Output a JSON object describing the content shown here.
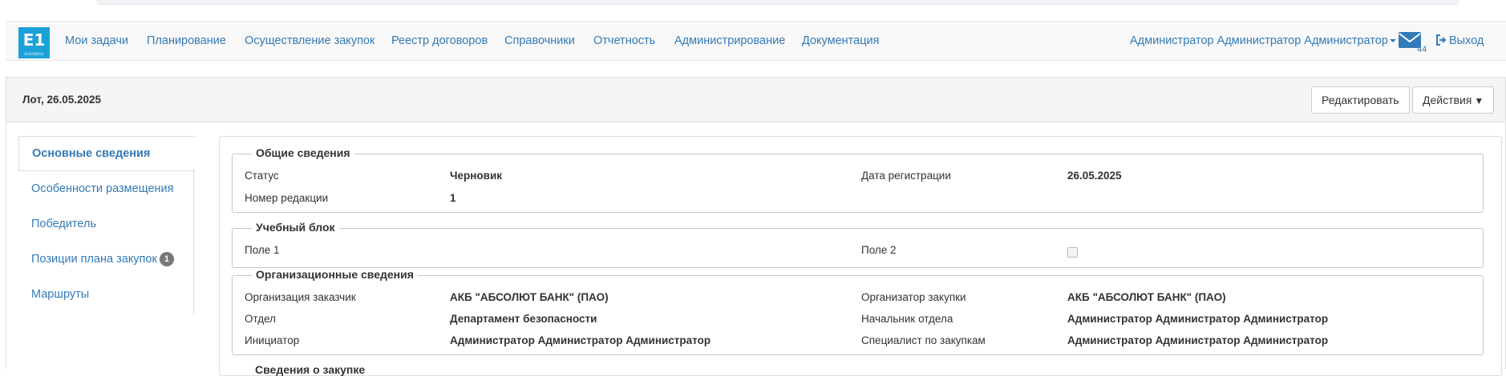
{
  "app": {
    "logo_text": "E1",
    "logo_subtext": "BUSINESS"
  },
  "nav": {
    "items": [
      {
        "label": "Мои задачи"
      },
      {
        "label": "Планирование"
      },
      {
        "label": "Осуществление закупок"
      },
      {
        "label": "Реестр договоров"
      },
      {
        "label": "Справочники"
      },
      {
        "label": "Отчетность"
      },
      {
        "label": "Администрирование"
      },
      {
        "label": "Документация"
      }
    ],
    "user": "Администратор Администратор Администратор",
    "mail_count": "44",
    "logout": "Выход"
  },
  "header": {
    "title": "Лот, 26.05.2025",
    "edit_button": "Редактировать",
    "actions_button": "Действия"
  },
  "sidebar": {
    "items": [
      {
        "label": "Основные сведения",
        "active": true
      },
      {
        "label": "Особенности размещения"
      },
      {
        "label": "Победитель"
      },
      {
        "label": "Позиции плана закупок",
        "badge": "1"
      },
      {
        "label": "Маршруты"
      }
    ]
  },
  "sections": {
    "general": {
      "legend": "Общие сведения",
      "status_label": "Статус",
      "status_value": "Черновик",
      "reg_date_label": "Дата регистрации",
      "reg_date_value": "26.05.2025",
      "edition_label": "Номер редакции",
      "edition_value": "1"
    },
    "training": {
      "legend": "Учебный блок",
      "field1_label": "Поле 1",
      "field2_label": "Поле 2",
      "field2_checked": false
    },
    "org": {
      "legend": "Организационные сведения",
      "customer_label": "Организация заказчик",
      "customer_value": "АКБ \"АБСОЛЮТ БАНК\" (ПАО)",
      "organizer_label": "Организатор закупки",
      "organizer_value": "АКБ \"АБСОЛЮТ БАНК\" (ПАО)",
      "dept_label": "Отдел",
      "dept_value": "Департамент безопасности",
      "head_label": "Начальник отдела",
      "head_value": "Администратор Администратор Администратор",
      "initiator_label": "Инициатор",
      "initiator_value": "Администратор Администратор Администратор",
      "specialist_label": "Специалист по закупкам",
      "specialist_value": "Администратор Администратор Администратор"
    },
    "purchase": {
      "legend": "Сведения о закупке"
    }
  },
  "colors": {
    "link": "#337ab7",
    "logo_bg": "#1ba1d8",
    "badge_bg": "#777777"
  }
}
